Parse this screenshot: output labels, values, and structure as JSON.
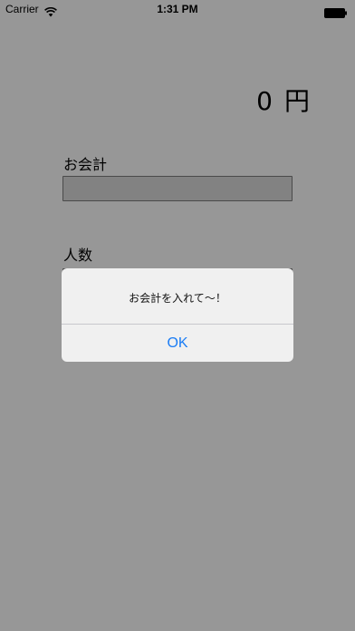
{
  "status_bar": {
    "carrier": "Carrier",
    "time": "1:31 PM"
  },
  "total": {
    "amount": "0",
    "unit": "円"
  },
  "form": {
    "bill_label": "お会計",
    "bill_value": "",
    "people_label": "人数"
  },
  "alert": {
    "message": "お会計を入れて〜！",
    "ok_label": "OK"
  },
  "colors": {
    "background": "#979797",
    "alert_background": "#f0f0f0",
    "accent": "#1a7cf5"
  }
}
